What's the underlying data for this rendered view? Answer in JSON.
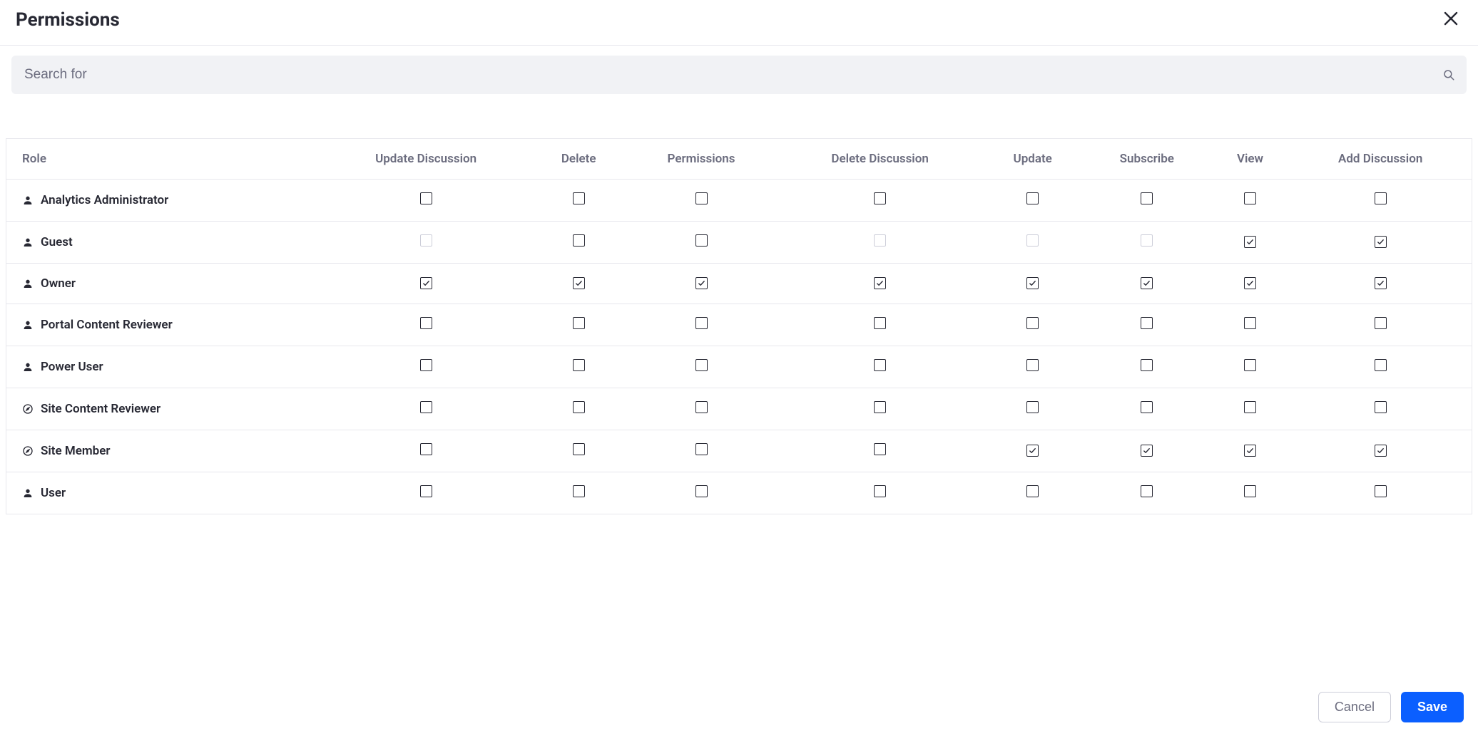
{
  "header": {
    "title": "Permissions"
  },
  "search": {
    "placeholder": "Search for"
  },
  "columns": [
    {
      "key": "role",
      "label": "Role"
    },
    {
      "key": "update_discussion",
      "label": "Update Discussion"
    },
    {
      "key": "delete",
      "label": "Delete"
    },
    {
      "key": "permissions",
      "label": "Permissions"
    },
    {
      "key": "delete_discussion",
      "label": "Delete Discussion"
    },
    {
      "key": "update",
      "label": "Update"
    },
    {
      "key": "subscribe",
      "label": "Subscribe"
    },
    {
      "key": "view",
      "label": "View"
    },
    {
      "key": "add_discussion",
      "label": "Add Discussion"
    }
  ],
  "roles": [
    {
      "name": "Analytics Administrator",
      "icon": "user",
      "cells": {
        "update_discussion": {
          "checked": false,
          "disabled": false
        },
        "delete": {
          "checked": false,
          "disabled": false
        },
        "permissions": {
          "checked": false,
          "disabled": false
        },
        "delete_discussion": {
          "checked": false,
          "disabled": false
        },
        "update": {
          "checked": false,
          "disabled": false
        },
        "subscribe": {
          "checked": false,
          "disabled": false
        },
        "view": {
          "checked": false,
          "disabled": false
        },
        "add_discussion": {
          "checked": false,
          "disabled": false
        }
      }
    },
    {
      "name": "Guest",
      "icon": "user",
      "cells": {
        "update_discussion": {
          "checked": false,
          "disabled": true
        },
        "delete": {
          "checked": false,
          "disabled": false
        },
        "permissions": {
          "checked": false,
          "disabled": false
        },
        "delete_discussion": {
          "checked": false,
          "disabled": true
        },
        "update": {
          "checked": false,
          "disabled": true
        },
        "subscribe": {
          "checked": false,
          "disabled": true
        },
        "view": {
          "checked": true,
          "disabled": false
        },
        "add_discussion": {
          "checked": true,
          "disabled": false
        }
      }
    },
    {
      "name": "Owner",
      "icon": "user",
      "cells": {
        "update_discussion": {
          "checked": true,
          "disabled": false
        },
        "delete": {
          "checked": true,
          "disabled": false
        },
        "permissions": {
          "checked": true,
          "disabled": false
        },
        "delete_discussion": {
          "checked": true,
          "disabled": false
        },
        "update": {
          "checked": true,
          "disabled": false
        },
        "subscribe": {
          "checked": true,
          "disabled": false
        },
        "view": {
          "checked": true,
          "disabled": false
        },
        "add_discussion": {
          "checked": true,
          "disabled": false
        }
      }
    },
    {
      "name": "Portal Content Reviewer",
      "icon": "user",
      "cells": {
        "update_discussion": {
          "checked": false,
          "disabled": false
        },
        "delete": {
          "checked": false,
          "disabled": false
        },
        "permissions": {
          "checked": false,
          "disabled": false
        },
        "delete_discussion": {
          "checked": false,
          "disabled": false
        },
        "update": {
          "checked": false,
          "disabled": false
        },
        "subscribe": {
          "checked": false,
          "disabled": false
        },
        "view": {
          "checked": false,
          "disabled": false
        },
        "add_discussion": {
          "checked": false,
          "disabled": false
        }
      }
    },
    {
      "name": "Power User",
      "icon": "user",
      "cells": {
        "update_discussion": {
          "checked": false,
          "disabled": false
        },
        "delete": {
          "checked": false,
          "disabled": false
        },
        "permissions": {
          "checked": false,
          "disabled": false
        },
        "delete_discussion": {
          "checked": false,
          "disabled": false
        },
        "update": {
          "checked": false,
          "disabled": false
        },
        "subscribe": {
          "checked": false,
          "disabled": false
        },
        "view": {
          "checked": false,
          "disabled": false
        },
        "add_discussion": {
          "checked": false,
          "disabled": false
        }
      }
    },
    {
      "name": "Site Content Reviewer",
      "icon": "compass",
      "cells": {
        "update_discussion": {
          "checked": false,
          "disabled": false
        },
        "delete": {
          "checked": false,
          "disabled": false
        },
        "permissions": {
          "checked": false,
          "disabled": false
        },
        "delete_discussion": {
          "checked": false,
          "disabled": false
        },
        "update": {
          "checked": false,
          "disabled": false
        },
        "subscribe": {
          "checked": false,
          "disabled": false
        },
        "view": {
          "checked": false,
          "disabled": false
        },
        "add_discussion": {
          "checked": false,
          "disabled": false
        }
      }
    },
    {
      "name": "Site Member",
      "icon": "compass",
      "cells": {
        "update_discussion": {
          "checked": false,
          "disabled": false
        },
        "delete": {
          "checked": false,
          "disabled": false
        },
        "permissions": {
          "checked": false,
          "disabled": false
        },
        "delete_discussion": {
          "checked": false,
          "disabled": false
        },
        "update": {
          "checked": true,
          "disabled": false
        },
        "subscribe": {
          "checked": true,
          "disabled": false
        },
        "view": {
          "checked": true,
          "disabled": false
        },
        "add_discussion": {
          "checked": true,
          "disabled": false
        }
      }
    },
    {
      "name": "User",
      "icon": "user",
      "cells": {
        "update_discussion": {
          "checked": false,
          "disabled": false
        },
        "delete": {
          "checked": false,
          "disabled": false
        },
        "permissions": {
          "checked": false,
          "disabled": false
        },
        "delete_discussion": {
          "checked": false,
          "disabled": false
        },
        "update": {
          "checked": false,
          "disabled": false
        },
        "subscribe": {
          "checked": false,
          "disabled": false
        },
        "view": {
          "checked": false,
          "disabled": false
        },
        "add_discussion": {
          "checked": false,
          "disabled": false
        }
      }
    }
  ],
  "footer": {
    "cancel_label": "Cancel",
    "save_label": "Save"
  }
}
